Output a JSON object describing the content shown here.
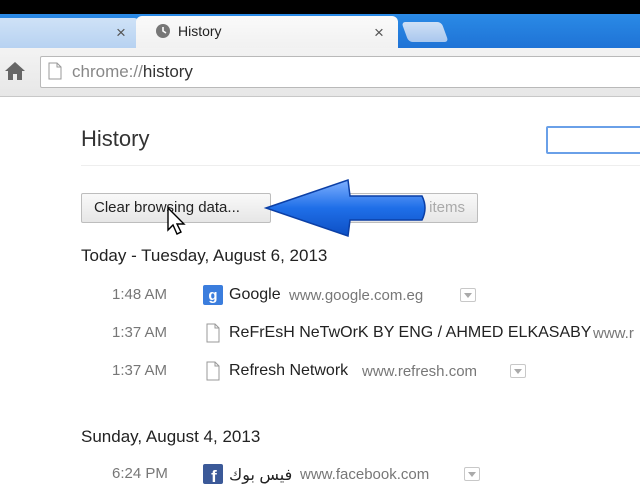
{
  "browser": {
    "inactive_tab_close": "×",
    "active_tab": {
      "title": "History",
      "close": "×"
    },
    "url_scheme": "chrome://",
    "url_path": "history"
  },
  "page": {
    "title": "History",
    "search_value": "",
    "clear_button": "Clear browsing data...",
    "remove_button": "items"
  },
  "days": [
    {
      "header": "Today - Tuesday, August 6, 2013",
      "entries": [
        {
          "time": "1:48 AM",
          "title": "Google",
          "url": "www.google.com.eg",
          "icon": "google-icon"
        },
        {
          "time": "1:37 AM",
          "title": "ReFrEsH NeTwOrK BY ENG / AHMED ELKASABY",
          "url": "www.r",
          "icon": "page-icon"
        },
        {
          "time": "1:37 AM",
          "title": "Refresh Network",
          "url": "www.refresh.com",
          "icon": "page-icon"
        }
      ]
    },
    {
      "header": "Sunday, August 4, 2013",
      "entries": [
        {
          "time": "6:24 PM",
          "title": "فيس بوك",
          "url": "www.facebook.com",
          "icon": "facebook-icon"
        }
      ]
    }
  ],
  "colors": {
    "tabstrip": "#1f73d6",
    "arrow": "#1566e0",
    "search_focus": "#6aa0e8"
  }
}
